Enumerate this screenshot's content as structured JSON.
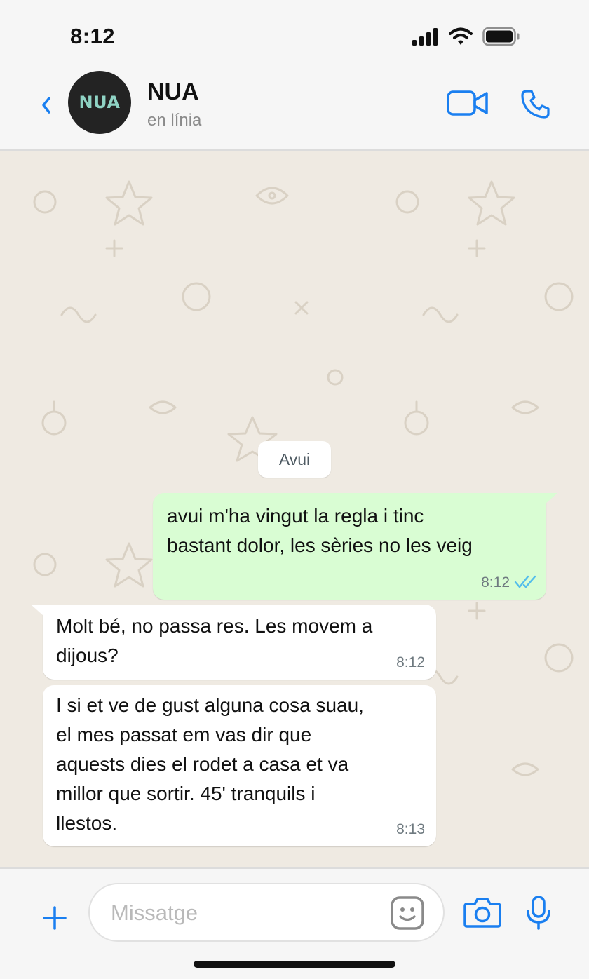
{
  "status_bar": {
    "time": "8:12"
  },
  "header": {
    "avatar_text": "NUA",
    "contact_name": "NUA",
    "contact_status": "en línia"
  },
  "chat": {
    "date_label": "Avui",
    "messages": [
      {
        "direction": "outgoing",
        "lines": [
          "avui m'ha vingut la regla i tinc",
          "bastant dolor, les sèries no les veig"
        ],
        "time": "8:12",
        "read": true
      },
      {
        "direction": "incoming",
        "lines": [
          "Molt bé, no passa res. Les movem a",
          "dijous?"
        ],
        "time": "8:12"
      },
      {
        "direction": "incoming",
        "lines": [
          "I si et ve de gust alguna cosa suau,",
          "el mes passat em vas dir que",
          "aquests dies el rodet a casa et va",
          "millor que sortir. 45' tranquils i",
          "llestos."
        ],
        "time": "8:13"
      }
    ]
  },
  "composer": {
    "placeholder": "Missatge"
  },
  "colors": {
    "accent": "#1a7ff0",
    "outgoing_bubble": "#d9fdd3",
    "incoming_bubble": "#ffffff",
    "chat_background": "#efeae2",
    "read_ticks": "#53bdeb"
  }
}
